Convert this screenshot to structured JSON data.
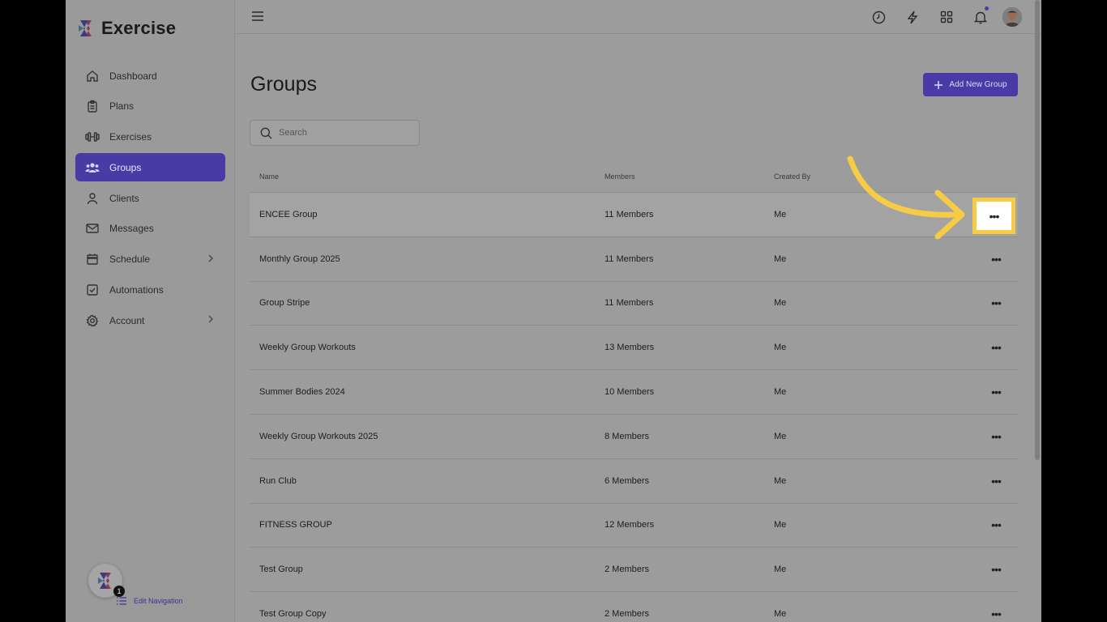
{
  "app": {
    "name": "Exercise"
  },
  "sidebar": {
    "items": [
      {
        "label": "Dashboard",
        "icon": "home-icon"
      },
      {
        "label": "Plans",
        "icon": "clipboard-icon"
      },
      {
        "label": "Exercises",
        "icon": "dumbbell-icon"
      },
      {
        "label": "Groups",
        "icon": "users-icon",
        "active": true
      },
      {
        "label": "Clients",
        "icon": "user-icon"
      },
      {
        "label": "Messages",
        "icon": "mail-icon"
      },
      {
        "label": "Schedule",
        "icon": "calendar-icon",
        "has_children": true
      },
      {
        "label": "Automations",
        "icon": "checkbox-icon"
      },
      {
        "label": "Account",
        "icon": "gear-icon",
        "has_children": true
      }
    ],
    "notification_count": "1",
    "edit_nav_label": "Edit Navigation"
  },
  "topbar": {
    "icons": [
      "menu-icon",
      "clock-icon",
      "bolt-icon",
      "grid-icon",
      "bell-icon"
    ]
  },
  "page": {
    "title": "Groups",
    "add_button_label": "Add New Group",
    "search_placeholder": "Search"
  },
  "table": {
    "headers": {
      "name": "Name",
      "members": "Members",
      "created_by": "Created By"
    },
    "rows": [
      {
        "name": "ENCEE Group",
        "members": "11 Members",
        "created_by": "Me"
      },
      {
        "name": "Monthly Group 2025",
        "members": "11 Members",
        "created_by": "Me"
      },
      {
        "name": "Group Stripe",
        "members": "11 Members",
        "created_by": "Me"
      },
      {
        "name": "Weekly Group Workouts",
        "members": "13 Members",
        "created_by": "Me"
      },
      {
        "name": "Summer Bodies 2024",
        "members": "10 Members",
        "created_by": "Me"
      },
      {
        "name": "Weekly Group Workouts 2025",
        "members": "8 Members",
        "created_by": "Me"
      },
      {
        "name": "Run Club",
        "members": "6 Members",
        "created_by": "Me"
      },
      {
        "name": "FITNESS GROUP",
        "members": "12 Members",
        "created_by": "Me"
      },
      {
        "name": "Test Group",
        "members": "2 Members",
        "created_by": "Me"
      },
      {
        "name": "Test Group Copy",
        "members": "2 Members",
        "created_by": "Me"
      }
    ],
    "row_action_glyph": "•••"
  },
  "colors": {
    "accent": "#4a3aa6",
    "annotation": "#f7cb46"
  }
}
